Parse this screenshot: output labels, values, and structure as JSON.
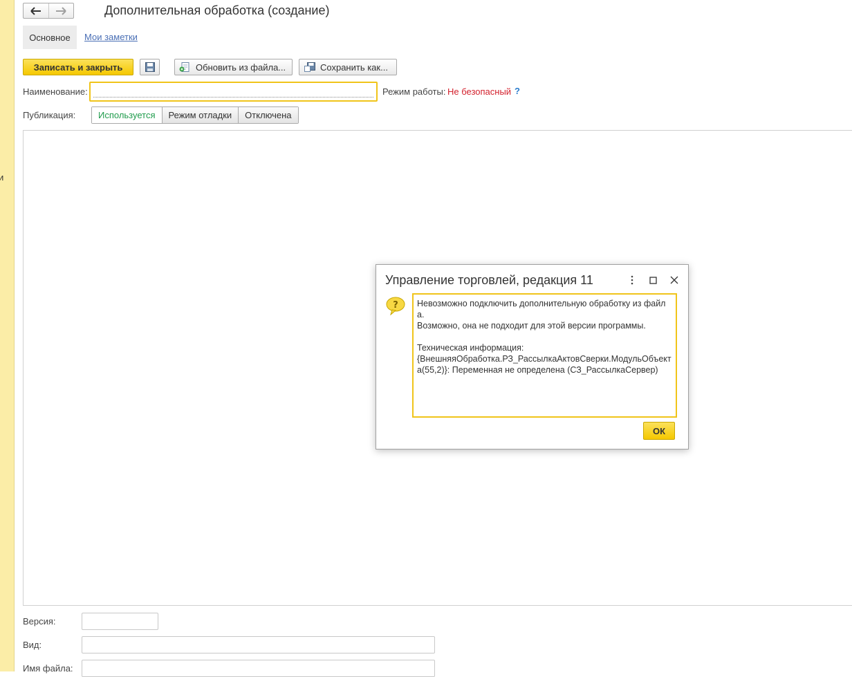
{
  "window": {
    "title": "Дополнительная обработка (создание)"
  },
  "left_strip": {
    "letter": "и"
  },
  "tabs": {
    "main": "Основное",
    "notes": "Мои заметки"
  },
  "toolbar": {
    "write_close": "Записать и закрыть",
    "reload_from_file": "Обновить из файла...",
    "save_as": "Сохранить как..."
  },
  "form": {
    "name_label": "Наименование:",
    "name_value": "",
    "mode_label": "Режим работы:",
    "mode_value": "Не безопасный",
    "mode_help": "?",
    "publication_label": "Публикация:",
    "publication_options": [
      "Используется",
      "Режим отладки",
      "Отключена"
    ],
    "publication_selected": "Используется",
    "version_label": "Версия:",
    "kind_label": "Вид:",
    "filename_label": "Имя файла:"
  },
  "dialog": {
    "title": "Управление торговлей, редакция 11",
    "message": "Невозможно подключить дополнительную обработку из файла.\nВозможно, она не подходит для этой версии программы.\n\nТехническая информация:\n{ВнешняяОбработка.РЗ_РассылкаАктовСверки.МодульОбъекта(55,2)}: Переменная не определена (СЗ_РассылкаСервер)",
    "ok": "ОК"
  },
  "colors": {
    "accent_yellow": "#f5c800",
    "active_green": "#1e9b4b",
    "warning_red": "#d3212d",
    "link_blue": "#4a6fb5",
    "side_strip": "#fbeda7"
  },
  "icons": {
    "back": "arrow-left-icon",
    "forward": "arrow-right-icon",
    "save": "floppy-disk-icon",
    "reload": "reload-from-file-icon",
    "save_as": "save-as-icon",
    "question": "question-bubble-icon",
    "more": "more-vertical-icon",
    "maximize": "maximize-icon",
    "close": "close-icon"
  }
}
